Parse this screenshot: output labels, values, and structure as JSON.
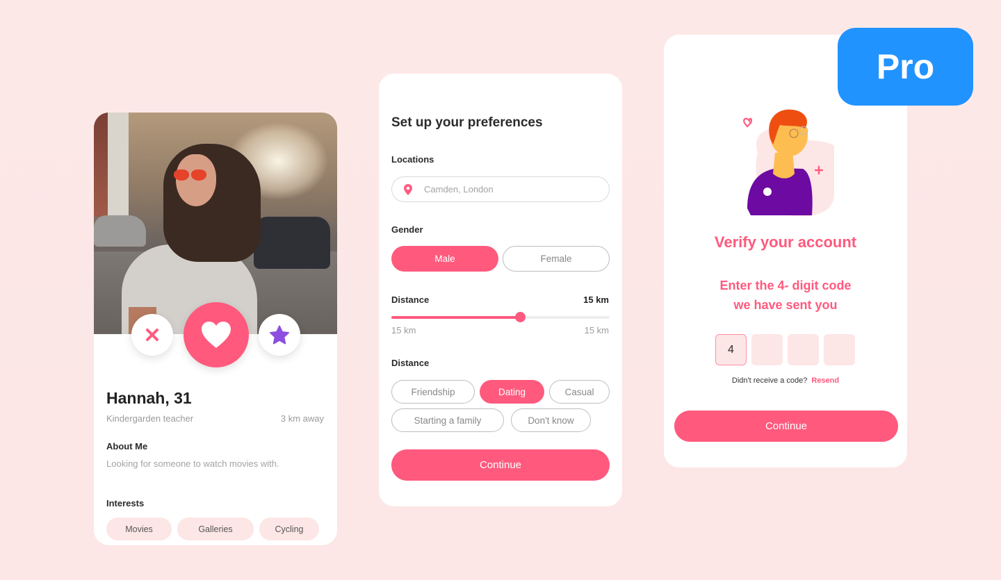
{
  "colors": {
    "brand": "#ff5a7e",
    "star": "#8c4ee0",
    "chip_bg": "#fde6e6",
    "pro_badge": "#2193ff",
    "background": "#fde8e8"
  },
  "profile": {
    "photo_alt": "Woman with sunglasses smiling on a street",
    "actions": {
      "dislike_icon": "close-icon",
      "like_icon": "heart-icon",
      "superlike_icon": "star-icon"
    },
    "name": "Hannah, 31",
    "occupation": "Kindergarden teacher",
    "distance": "3 km away",
    "about_label": "About Me",
    "about_text": "Looking for someone to watch movies with.",
    "interests_label": "Interests",
    "interests": [
      "Movies",
      "Galleries",
      "Cycling"
    ]
  },
  "preferences": {
    "title": "Set up your preferences",
    "locations_label": "Locations",
    "location_placeholder": "Camden, London",
    "location_icon": "map-pin-icon",
    "gender_label": "Gender",
    "gender_options": [
      "Male",
      "Female"
    ],
    "gender_selected": "Male",
    "distance_label": "Distance",
    "distance_value": "15 km",
    "slider": {
      "fraction": 0.59,
      "min_label": "15 km",
      "max_label": "15 km"
    },
    "relationship_label": "Distance",
    "relationship_options": [
      "Friendship",
      "Dating",
      "Casual",
      "Starting a family",
      "Don't know"
    ],
    "relationship_selected": "Dating",
    "continue_label": "Continue"
  },
  "verify": {
    "title": "Verify your account",
    "subtitle_line1": "Enter the 4- digit code",
    "subtitle_line2": "we have sent you",
    "code_digits": [
      "4",
      "",
      "",
      ""
    ],
    "resend_prompt": "Didn't receive a code?",
    "resend_label": "Resend",
    "continue_label": "Continue"
  },
  "badge": {
    "label": "Pro"
  }
}
